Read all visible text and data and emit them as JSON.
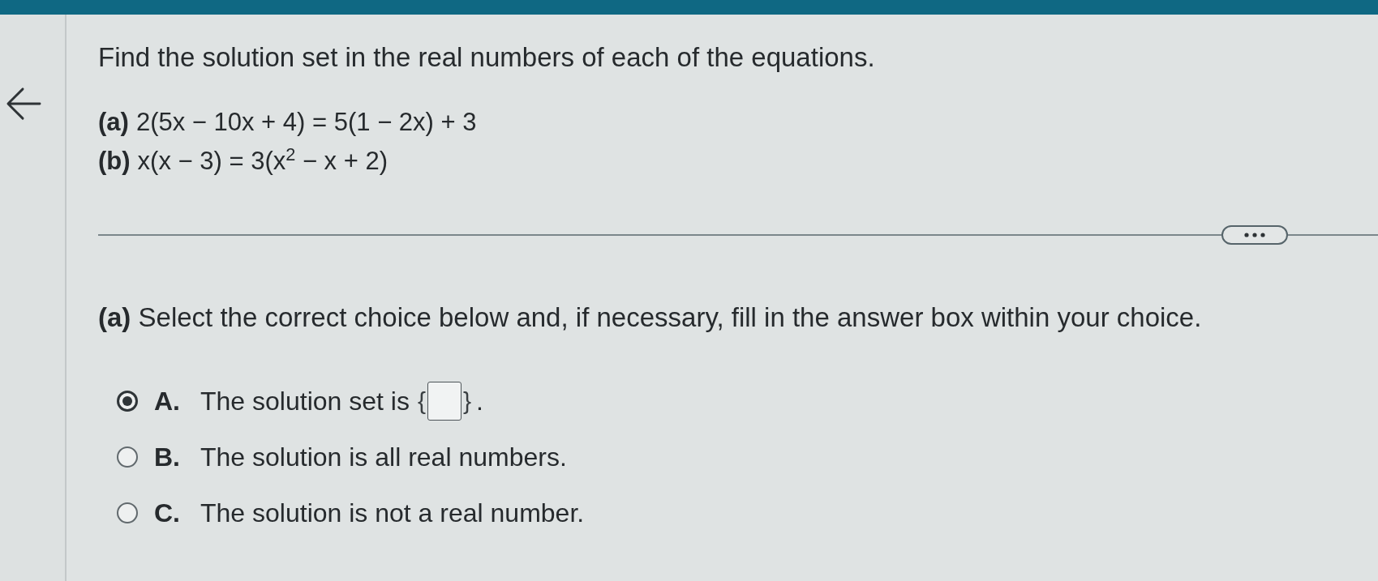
{
  "instructions": "Find the solution set in the real numbers of each of the equations.",
  "parts": [
    {
      "label": "(a)",
      "equation": "2(5x − 10x + 4) = 5(1 − 2x) + 3"
    },
    {
      "label": "(b)",
      "equation": "x(x − 3) = 3(x$^{2}$ − x + 2)"
    }
  ],
  "prompt": "**(a)** Select the correct choice below and, if necessary, fill in the answer box within your choice.",
  "choices": [
    {
      "kind": "set_answer",
      "letter": "A.",
      "text": "The solution set is",
      "open_brace": "{",
      "close_brace": "}",
      "end": ".",
      "selected": true
    },
    {
      "kind": "statement",
      "letter": "B.",
      "text": "The solution is all real numbers.",
      "selected": false
    },
    {
      "kind": "statement",
      "letter": "C.",
      "text": "The solution is not a real number.",
      "selected": false
    }
  ]
}
